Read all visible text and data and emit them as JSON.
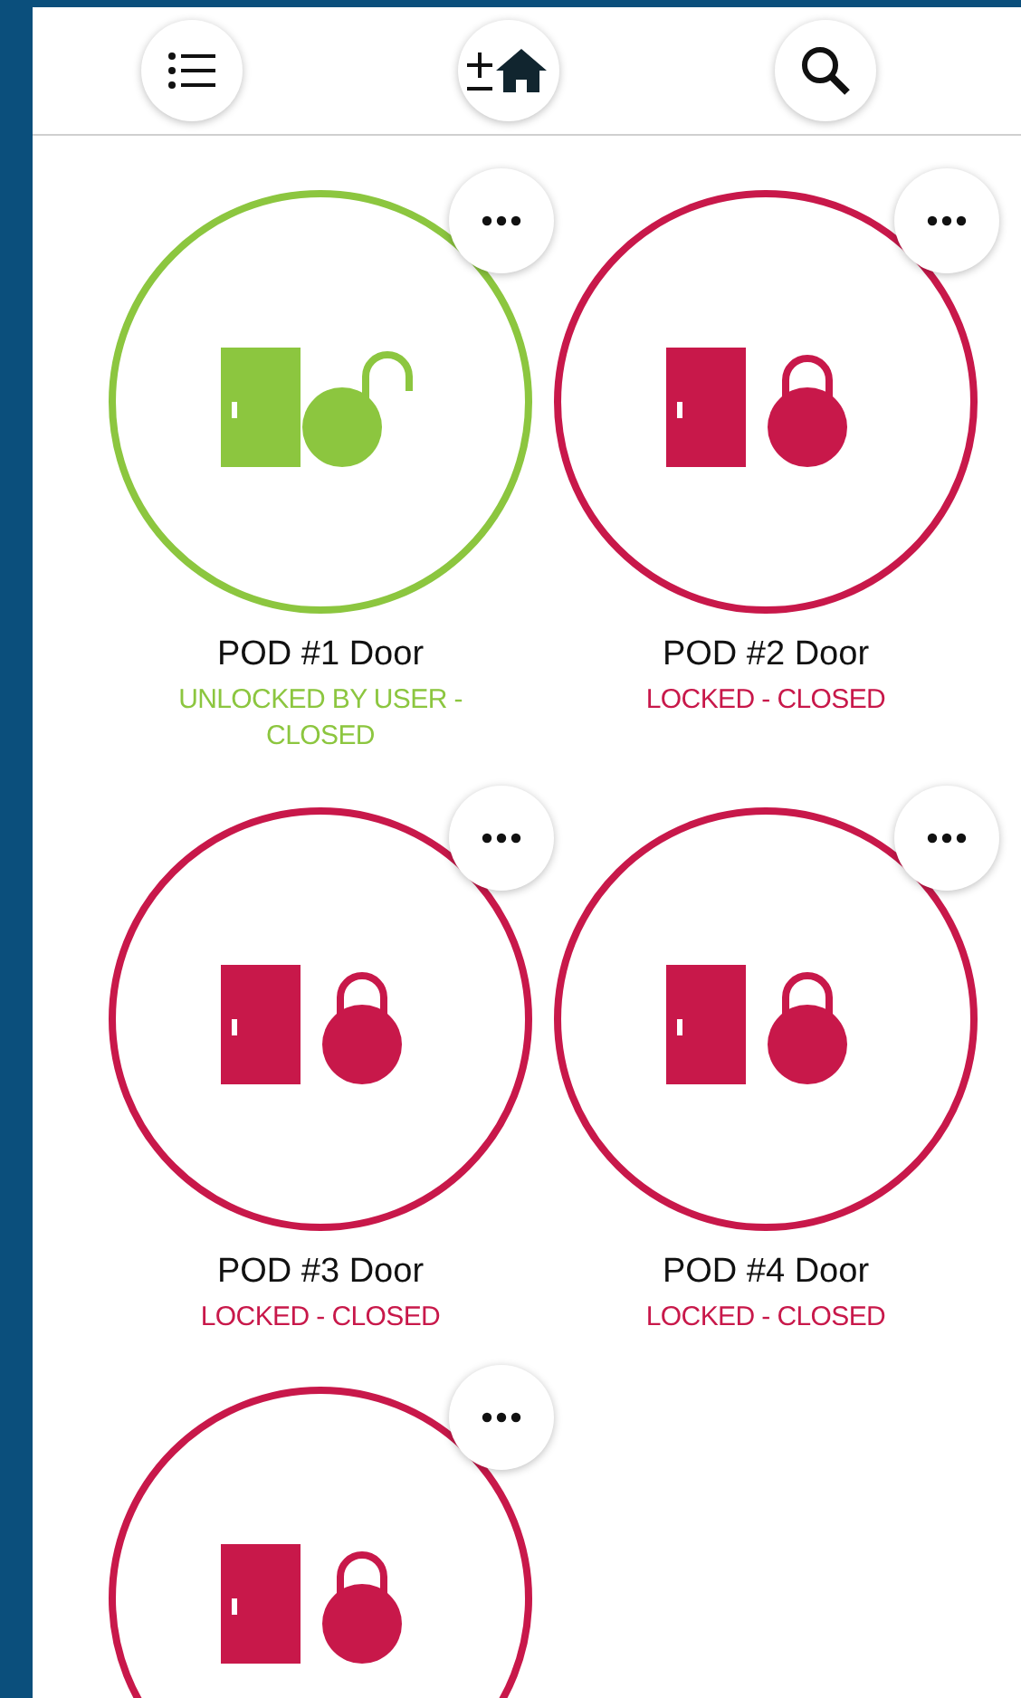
{
  "toolbar": {
    "buttons": [
      {
        "kind": "list"
      },
      {
        "kind": "home"
      },
      {
        "kind": "search"
      }
    ]
  },
  "doors": [
    {
      "name": "POD #1 Door",
      "status": "UNLOCKED BY USER - CLOSED",
      "kind": "unlocked"
    },
    {
      "name": "POD #2 Door",
      "status": "LOCKED - CLOSED",
      "kind": "locked"
    },
    {
      "name": "POD #3 Door",
      "status": "LOCKED - CLOSED",
      "kind": "locked"
    },
    {
      "name": "POD #4 Door",
      "status": "LOCKED - CLOSED",
      "kind": "locked"
    },
    {
      "kind": "locked"
    }
  ]
}
